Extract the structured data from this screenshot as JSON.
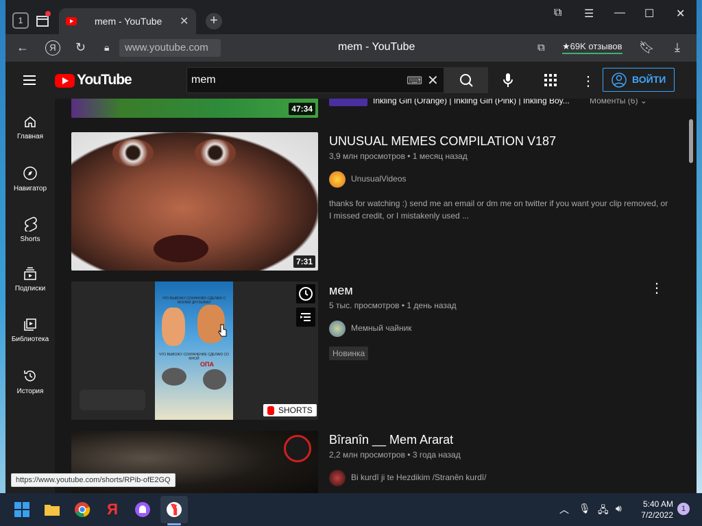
{
  "browser": {
    "tab_count": "1",
    "tab_title": "mem - YouTube",
    "url": "www.youtube.com",
    "page_title": "mem - YouTube",
    "reviews": "★69K отзывов",
    "status_url": "https://www.youtube.com/shorts/RPib-ofE2GQ"
  },
  "youtube": {
    "logo_text": "YouTube",
    "search_query": "mem",
    "signin_label": "ВОЙТИ",
    "sidebar": [
      {
        "label": "Главная",
        "icon": "home-icon"
      },
      {
        "label": "Навигатор",
        "icon": "compass-icon"
      },
      {
        "label": "Shorts",
        "icon": "shorts-icon"
      },
      {
        "label": "Подписки",
        "icon": "subscriptions-icon"
      },
      {
        "label": "Библиотека",
        "icon": "library-icon"
      },
      {
        "label": "История",
        "icon": "history-icon"
      }
    ],
    "top_partial": {
      "duration": "47:34",
      "title_fragment": "Inkling Girl (Orange) | Inkling Girl (Pink) | Inkling Boy...",
      "moments": "Моменты (6)"
    },
    "videos": [
      {
        "title": "UNUSUAL MEMES COMPILATION V187",
        "meta": "3,9 млн просмотров • 1 месяц назад",
        "channel": "UnusualVideos",
        "description": "thanks for watching :) send me an email or dm me on twitter if you want your clip removed, or I missed credit, or I mistakenly used ...",
        "duration": "7:31"
      },
      {
        "title": "мем",
        "meta": "5 тыс. просмотров • 1 день назад",
        "channel": "Мемный чайник",
        "badge": "Новинка",
        "shorts_label": "SHORTS",
        "thumb_text1": "ЧТО ВЫВОЖУ СОХРАНЯЮ СДЕЛАЮ С МОИМИ ДРУЗЬЯМИ",
        "thumb_text2": "ЧТО ВЫВОЖУ СОХРАНЕНИЕ СДЕЛАЮ СО МНОЙ",
        "thumb_text3": "ОПА"
      },
      {
        "title": "Bîranîn __ Mem Ararat",
        "meta": "2,2 млн просмотров • 3 года назад",
        "channel": "Bi kurdî ji te Hezdikim /Stranên kurdî/"
      }
    ]
  },
  "taskbar": {
    "time": "5:40 AM",
    "date": "7/2/2022",
    "notifications": "1"
  },
  "colors": {
    "yt_red": "#ff0000",
    "link_blue": "#3ea6ff",
    "yt_bg": "#181818"
  }
}
